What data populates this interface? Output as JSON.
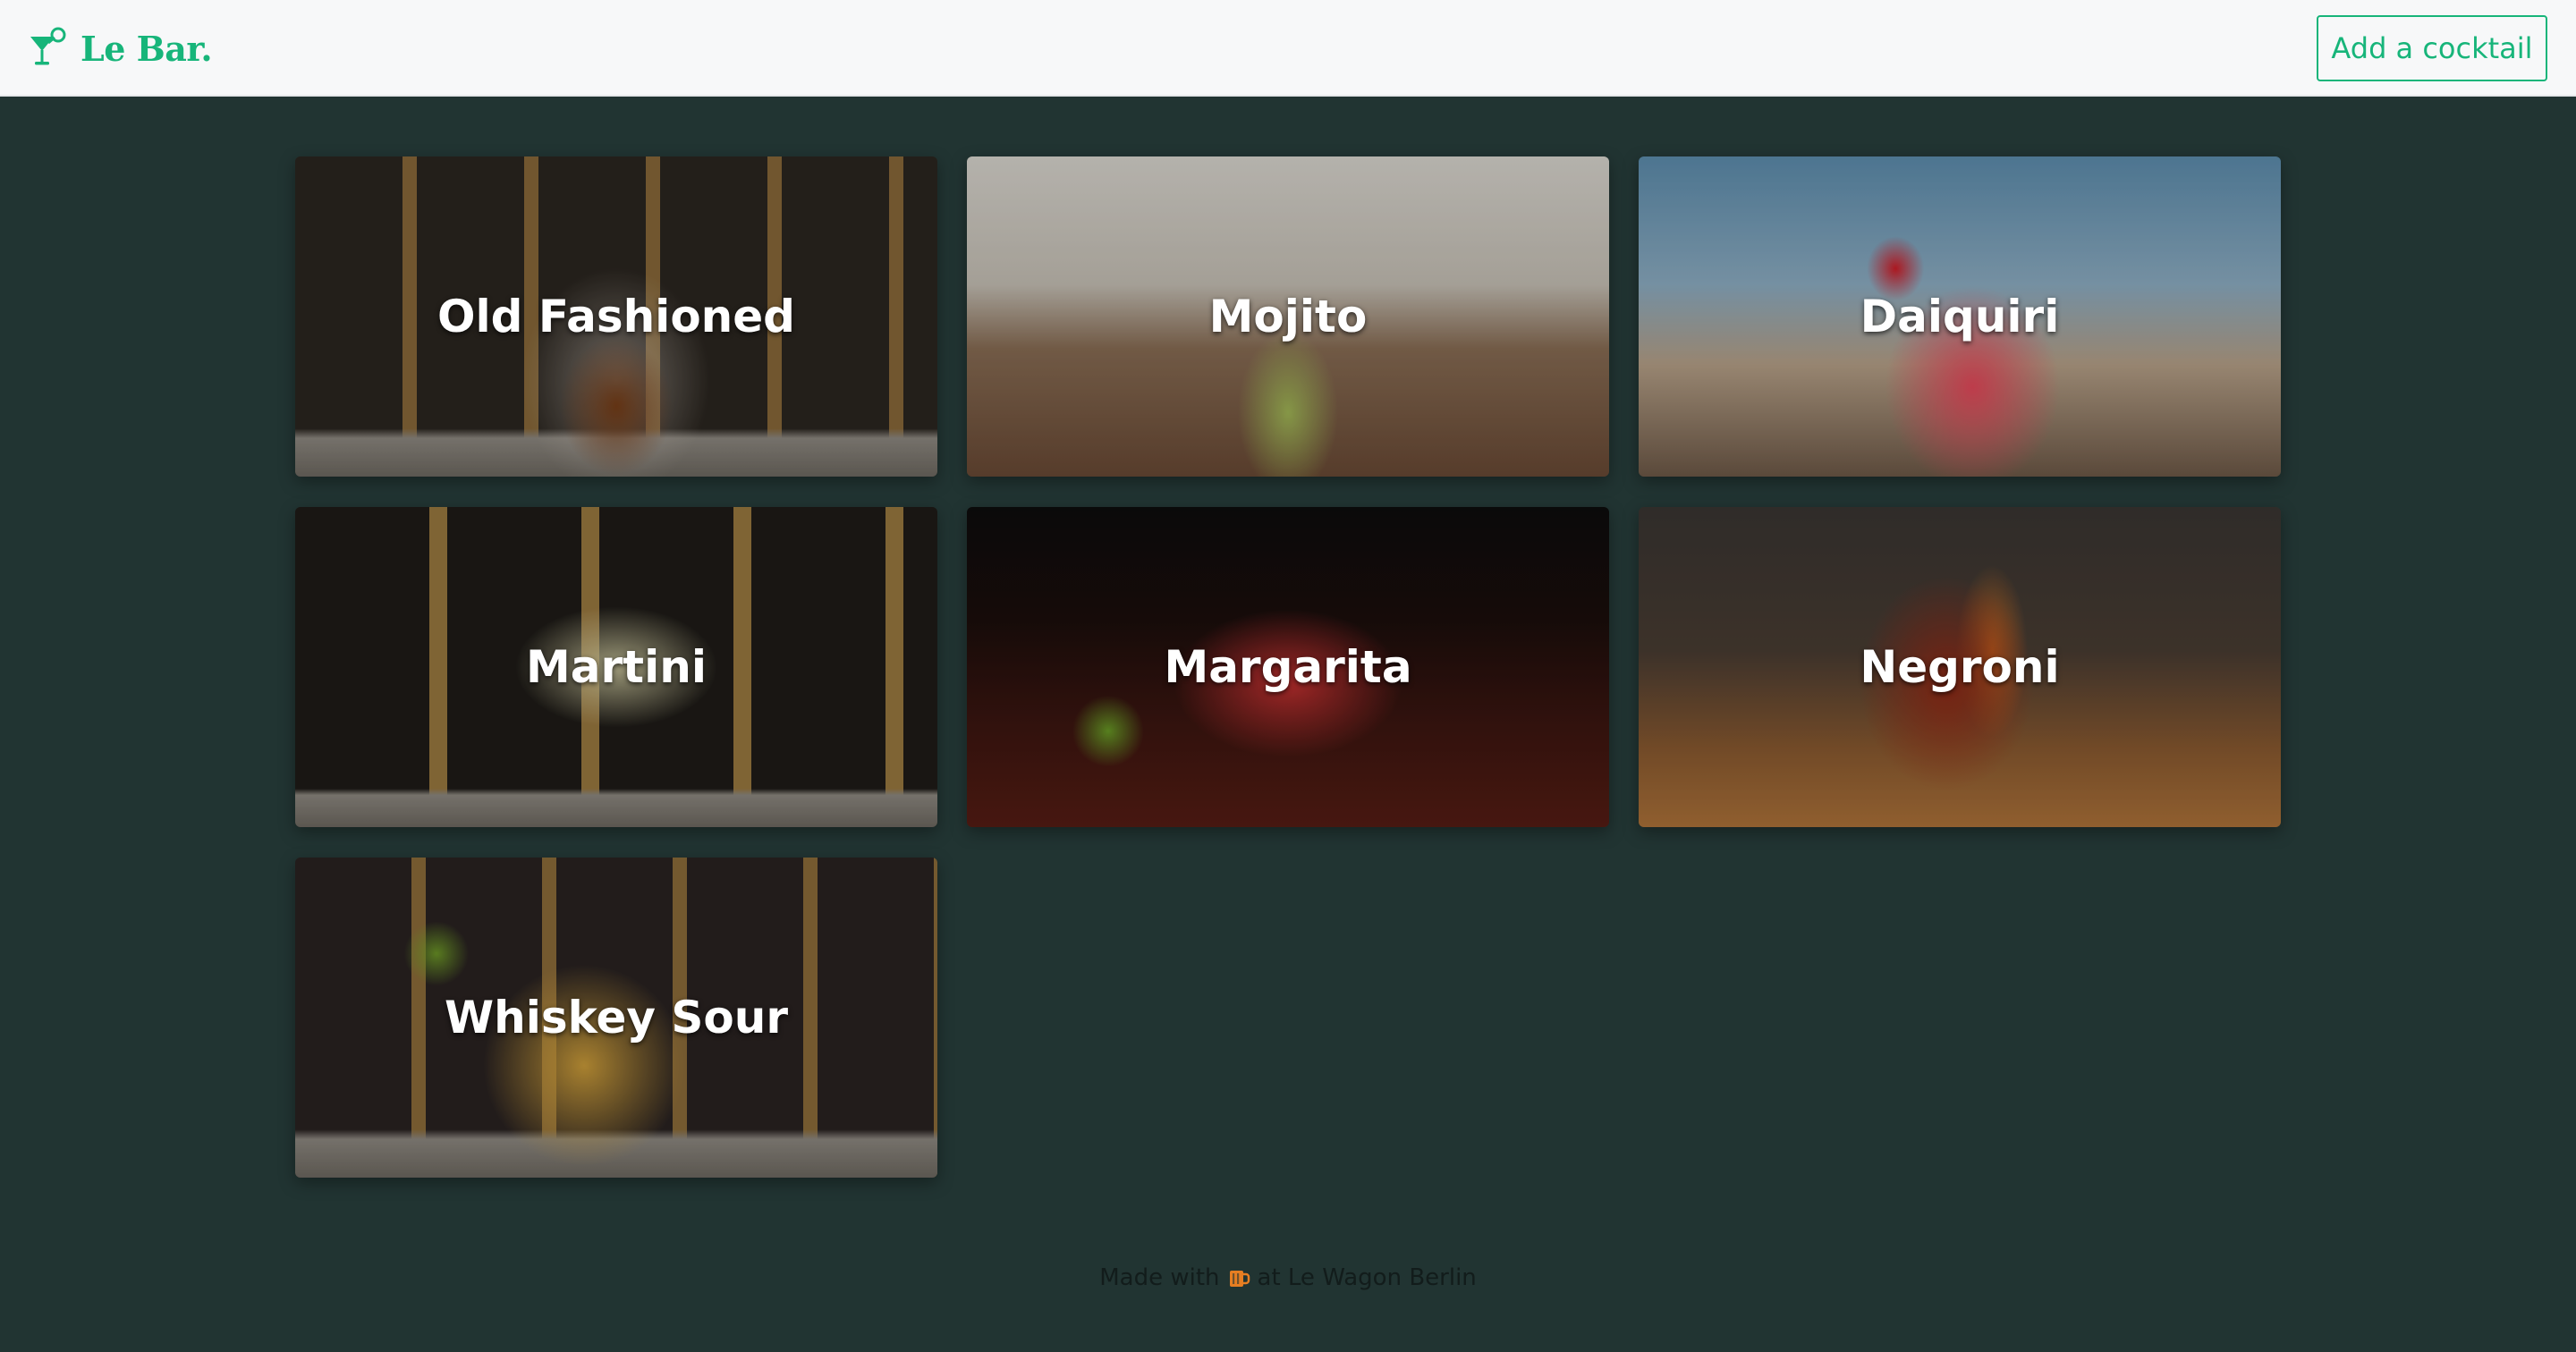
{
  "navbar": {
    "brand": "Le Bar.",
    "add_button": "Add a cocktail"
  },
  "cocktails": [
    {
      "name": "Old Fashioned"
    },
    {
      "name": "Mojito"
    },
    {
      "name": "Daiquiri"
    },
    {
      "name": "Martini"
    },
    {
      "name": "Margarita"
    },
    {
      "name": "Negroni"
    },
    {
      "name": "Whiskey Sour"
    }
  ],
  "footer": {
    "prefix": "Made with",
    "suffix": "at Le Wagon Berlin",
    "icon": "beer-mug-icon"
  },
  "colors": {
    "accent": "#17b57a",
    "background": "#213432",
    "navbar": "#f7f8f9",
    "footer_icon": "#e67e22"
  }
}
